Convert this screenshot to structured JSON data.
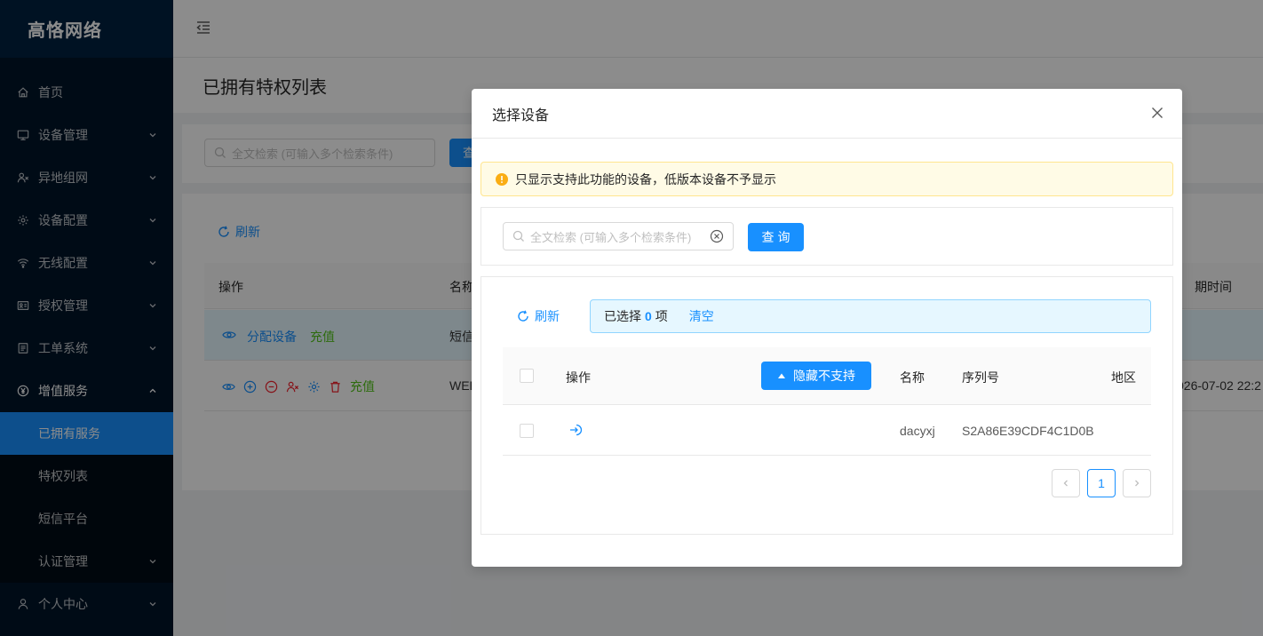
{
  "app": {
    "brand": "高恪网络"
  },
  "sidebar": {
    "items": [
      {
        "label": "首页",
        "icon": "home-icon"
      },
      {
        "label": "设备管理",
        "icon": "monitor-icon"
      },
      {
        "label": "异地组网",
        "icon": "network-icon"
      },
      {
        "label": "设备配置",
        "icon": "gear-icon"
      },
      {
        "label": "无线配置",
        "icon": "wifi-icon"
      },
      {
        "label": "授权管理",
        "icon": "id-card-icon"
      },
      {
        "label": "工单系统",
        "icon": "ticket-icon"
      },
      {
        "label": "增值服务",
        "icon": "yen-icon"
      }
    ],
    "sub_items": [
      {
        "label": "已拥有服务"
      },
      {
        "label": "特权列表"
      },
      {
        "label": "短信平台"
      },
      {
        "label": "认证管理"
      }
    ],
    "bottom_item": {
      "label": "个人中心",
      "icon": "user-icon"
    }
  },
  "page": {
    "title": "已拥有特权列表",
    "search_placeholder": "全文检索 (可输入多个检索条件)",
    "search_btn_partial": "查",
    "refresh": "刷新",
    "columns": {
      "action": "操作",
      "name_partial": "名称",
      "expire_partial": "期时间"
    },
    "rows": [
      {
        "assign": "分配设备",
        "recharge": "充值",
        "name_partial": "短信"
      },
      {
        "recharge": "充值",
        "name_partial": "WEB",
        "expire_partial": "026-07-02  22:2"
      }
    ]
  },
  "modal": {
    "title": "选择设备",
    "alert": "只显示支持此功能的设备，低版本设备不予显示",
    "search_placeholder": "全文检索 (可输入多个检索条件)",
    "query_btn": "查询",
    "refresh": "刷新",
    "selected_prefix": "已选择",
    "selected_count": "0",
    "selected_suffix": "项",
    "clear_link": "清空",
    "columns": {
      "action": "操作",
      "hide_btn": "隐藏不支持",
      "name": "名称",
      "serial": "序列号",
      "region": "地区"
    },
    "rows": [
      {
        "name": "dacyxj",
        "serial": "S2A86E39CDF4C1D0B",
        "region": ""
      }
    ],
    "pagination": {
      "current": "1"
    }
  },
  "colors": {
    "primary": "#1890ff",
    "sidebar_bg": "#001529",
    "success": "#52c41a",
    "danger": "#f5222d",
    "warning": "#faad14"
  }
}
